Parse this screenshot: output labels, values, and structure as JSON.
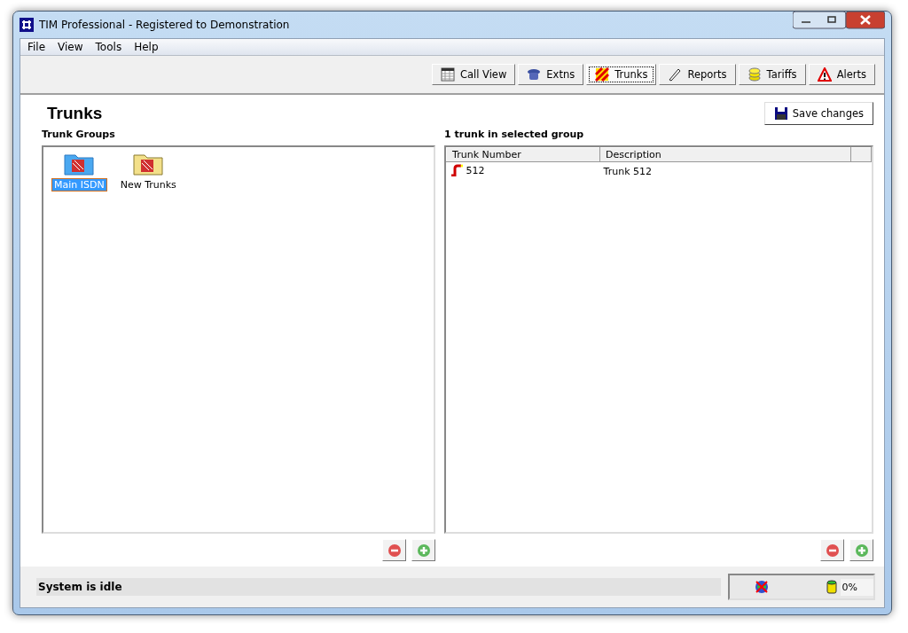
{
  "window": {
    "title": "TIM Professional - Registered to Demonstration"
  },
  "menu": [
    "File",
    "View",
    "Tools",
    "Help"
  ],
  "toolbar": [
    {
      "label": "Call View",
      "kind": "calls",
      "selected": false
    },
    {
      "label": "Extns",
      "kind": "phone",
      "selected": false
    },
    {
      "label": "Trunks",
      "kind": "trunks",
      "selected": true
    },
    {
      "label": "Reports",
      "kind": "reports",
      "selected": false
    },
    {
      "label": "Tariffs",
      "kind": "coins",
      "selected": false
    },
    {
      "label": "Alerts",
      "kind": "alert",
      "selected": false
    }
  ],
  "page_title": "Trunks",
  "save_button": "Save changes",
  "groups_panel": {
    "heading": "Trunk Groups",
    "items": [
      {
        "label": "Main ISDN",
        "selected": true
      },
      {
        "label": "New Trunks",
        "selected": false
      }
    ]
  },
  "trunks_panel": {
    "heading": "1 trunk in selected group",
    "columns": [
      "Trunk Number",
      "Description"
    ],
    "rows": [
      {
        "number": "512",
        "description": "Trunk 512"
      }
    ]
  },
  "status_bar": {
    "message": "System is idle",
    "usage": "0%"
  }
}
